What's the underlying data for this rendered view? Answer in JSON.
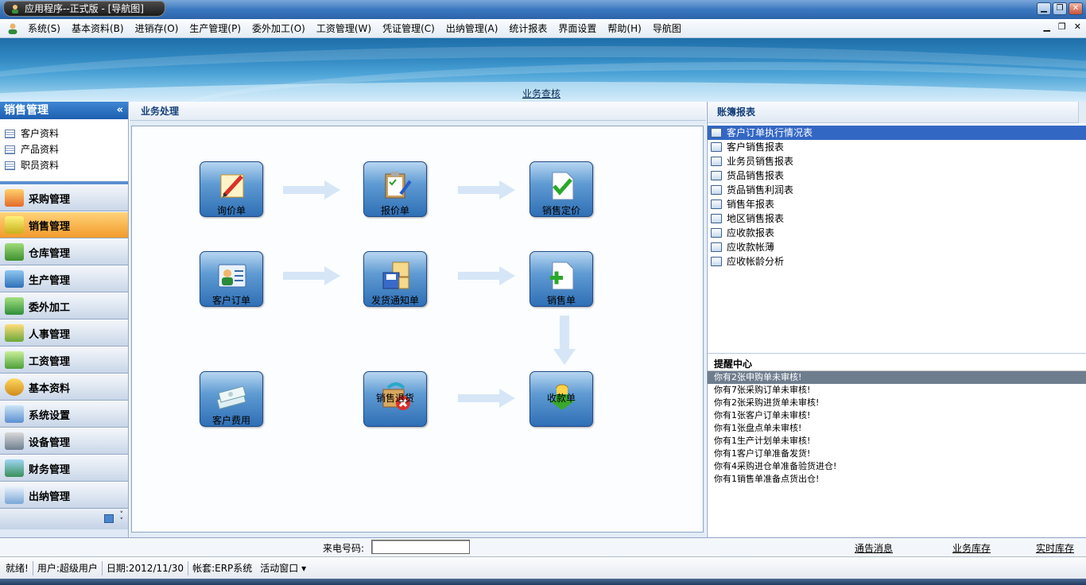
{
  "window": {
    "title": "应用程序--正式版 - [导航图]"
  },
  "menu": [
    "系统(S)",
    "基本资料(B)",
    "进销存(O)",
    "生产管理(P)",
    "委外加工(O)",
    "工资管理(W)",
    "凭证管理(C)",
    "出纳管理(A)",
    "统计报表",
    "界面设置",
    "帮助(H)",
    "导航图"
  ],
  "banner": {
    "link": "业务查核"
  },
  "sidebar": {
    "title": "销售管理",
    "sub_items": [
      "客户资料",
      "产品资料",
      "职员资料"
    ],
    "nav": [
      "采购管理",
      "销售管理",
      "仓库管理",
      "生产管理",
      "委外加工",
      "人事管理",
      "工资管理",
      "基本资料",
      "系统设置",
      "设备管理",
      "财务管理",
      "出纳管理"
    ],
    "active": "销售管理"
  },
  "main": {
    "title": "业务处理",
    "flow": {
      "inquiry": "询价单",
      "quote": "报价单",
      "pricing": "销售定价",
      "order": "客户订单",
      "delivery_notice": "发货通知单",
      "sales_order": "销售单",
      "expense": "客户费用",
      "return": "销售退货",
      "receipt": "收款单"
    }
  },
  "reports": {
    "title": "账簿报表",
    "items": [
      "客户订单执行情况表",
      "客户销售报表",
      "业务员销售报表",
      "货品销售报表",
      "货品销售利润表",
      "销售年报表",
      "地区销售报表",
      "应收款报表",
      "应收款帐薄",
      "应收帐龄分析"
    ]
  },
  "reminder": {
    "title": "提醒中心",
    "items": [
      "你有2张申购单未审核!",
      "你有7张采购订单未审核!",
      "你有2张采购进货单未审核!",
      "你有1张客户订单未审核!",
      "你有1张盘点单未审核!",
      "你有1生产计划单未审核!",
      "你有1客户订单准备发货!",
      "你有4采购进仓单准备验货进仓!",
      "你有1销售单准备点货出仓!"
    ]
  },
  "callbar": {
    "label": "来电号码:",
    "value": "",
    "links": [
      "通告消息",
      "业务库存",
      "实时库存"
    ]
  },
  "status": {
    "ready": "就绪!",
    "user": "用户:超级用户",
    "date": "日期:2012/11/30",
    "account": "帐套:ERP系统",
    "active_window": "活动窗口"
  },
  "colors": {
    "accent": "#1c5fb0",
    "active_nav": "#f39b2b",
    "selected_row": "#3367c4"
  }
}
